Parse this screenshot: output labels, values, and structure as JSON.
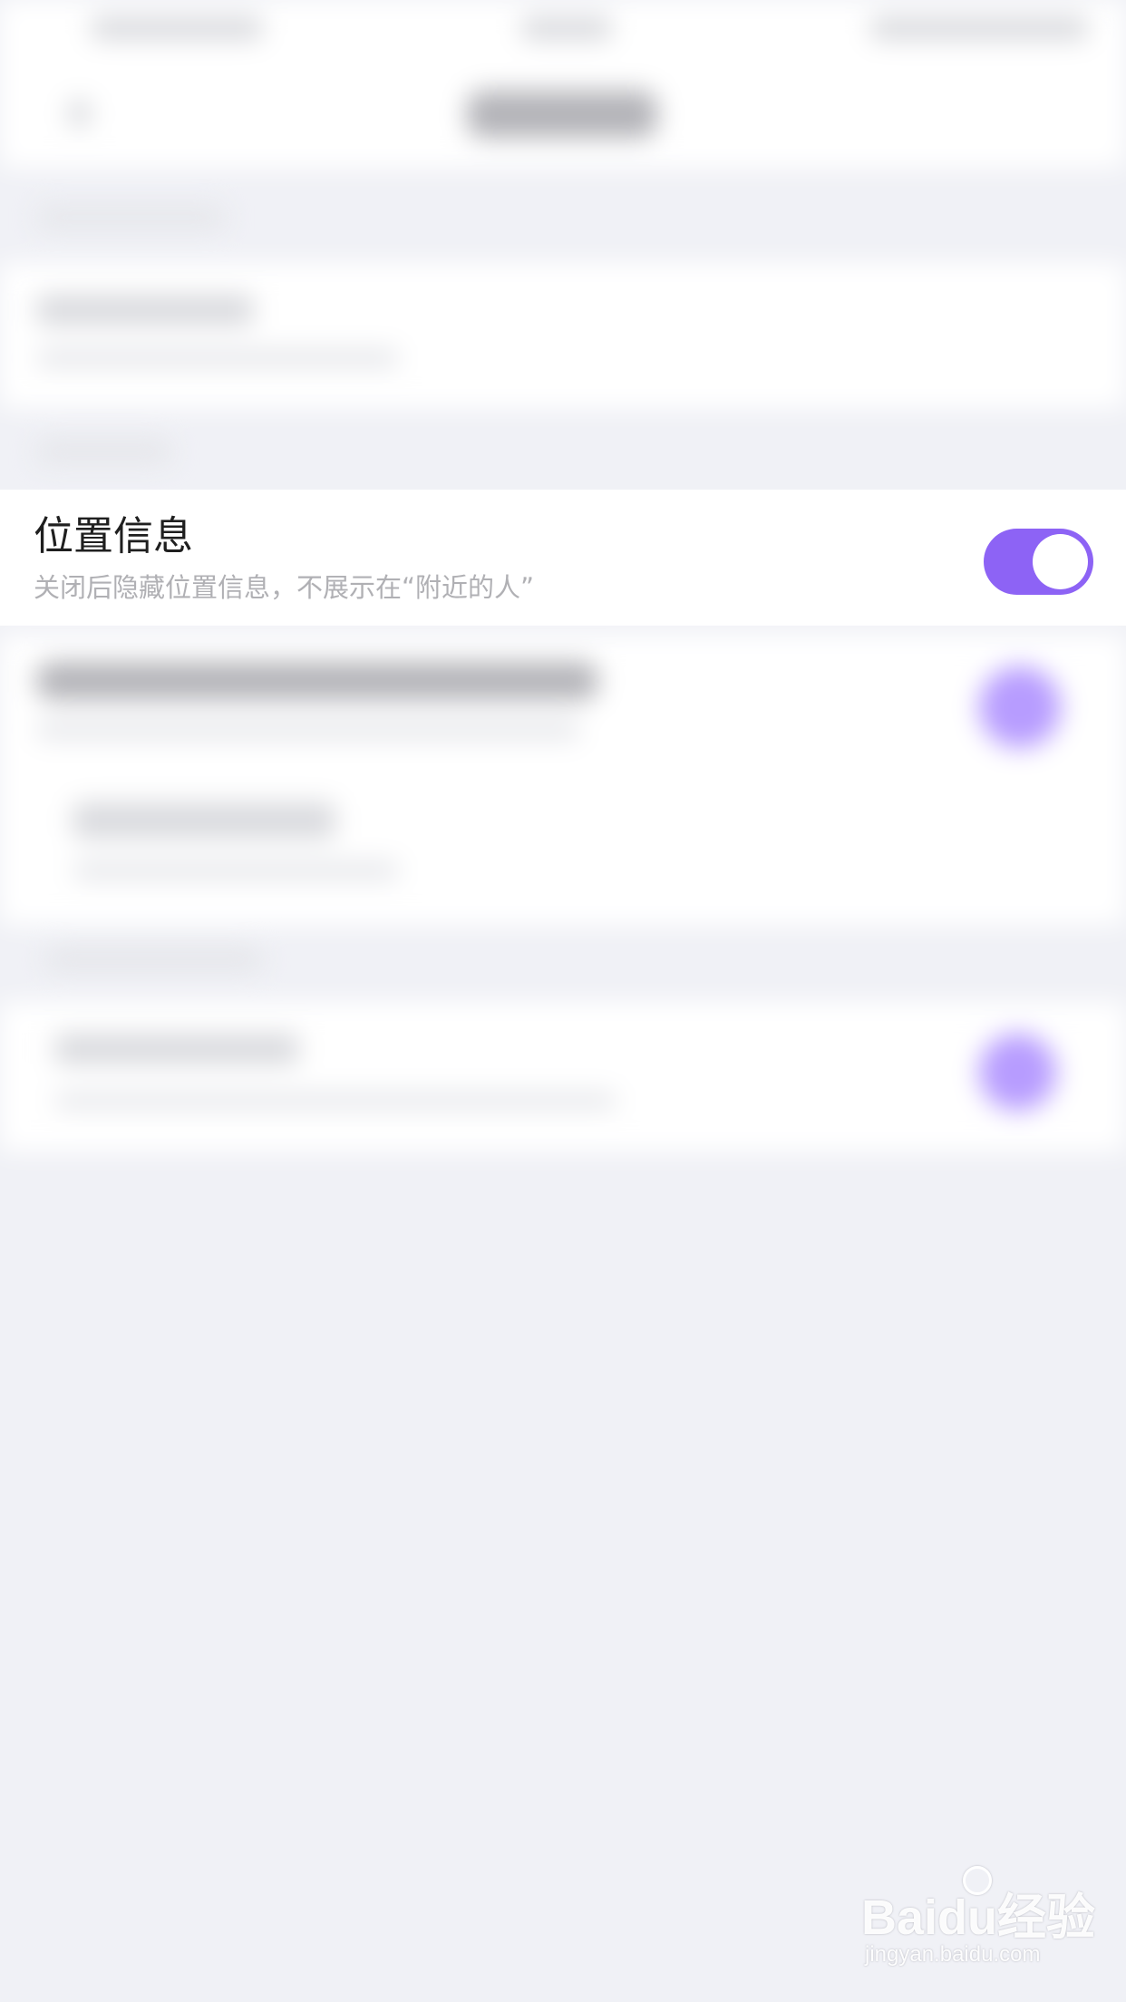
{
  "setting": {
    "title": "位置信息",
    "description": "关闭后隐藏位置信息，不展示在“附近的人”",
    "enabled": true,
    "toggle_color": "#8d63f5"
  },
  "watermark": {
    "brand": "Baidu经验",
    "url": "jingyan.baidu.com"
  }
}
